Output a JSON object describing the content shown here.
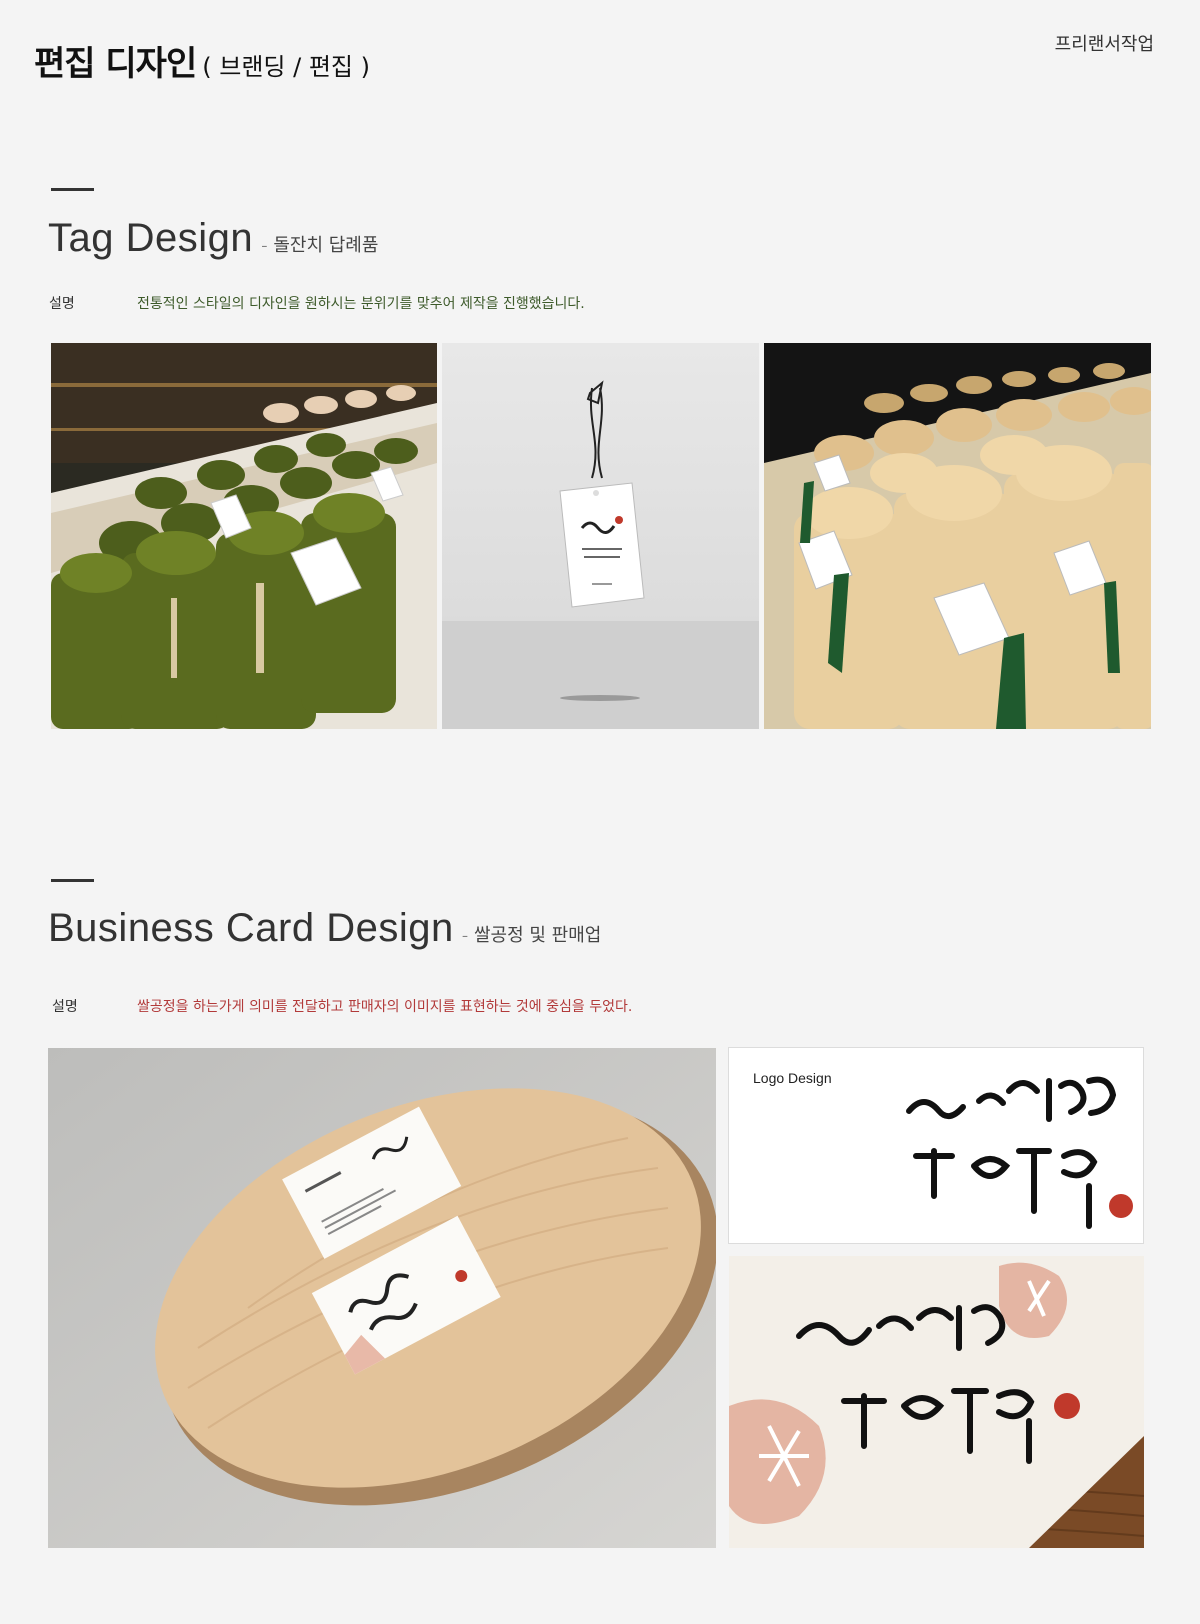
{
  "header": {
    "title": "편집 디자인",
    "subtitle": "( 브랜딩 / 편집 )",
    "top_right": "프리랜서작업"
  },
  "tag_section": {
    "title": "Tag Design",
    "subtitle": "- 돌잔치 답례품",
    "desc_label": "설명",
    "desc_text": "전통적인 스타일의 디자인을 원하시는 분위기를 맞추어 제작을 진행했습니다.",
    "desc_color": "#3d5a2a"
  },
  "card_section": {
    "title": "Business Card Design",
    "subtitle": "- 쌀공정 및 판매업",
    "desc_label": "설명",
    "desc_text": "쌀공정을 하는가게 의미를 전달하고 판매자의 이미지를 표현하는 것에 중심을 두었다.",
    "desc_color": "#b23a3a",
    "logo_label": "Logo Design"
  }
}
